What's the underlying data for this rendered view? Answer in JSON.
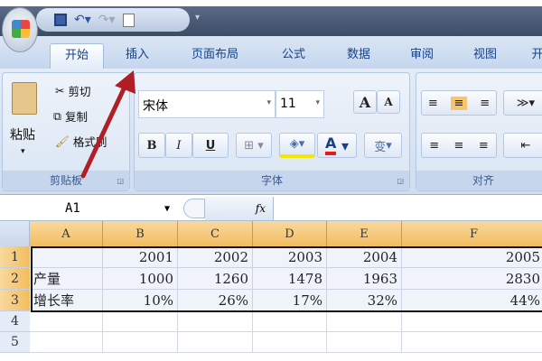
{
  "tabs": [
    "开始",
    "插入",
    "页面布局",
    "公式",
    "数据",
    "审阅",
    "视图",
    "开"
  ],
  "clipboard": {
    "paste": "粘贴",
    "cut": "剪切",
    "copy": "复制",
    "format_painter": "格式刷",
    "label": "剪贴板"
  },
  "font": {
    "name": "宋体",
    "size": "11",
    "grow": "A",
    "shrink": "A",
    "bold": "B",
    "italic": "I",
    "underline": "U",
    "font_color": "A",
    "phonetic": "变",
    "label": "字体"
  },
  "alignment": {
    "label": "对齐"
  },
  "formula_bar": {
    "name_box": "A1",
    "fx": "fx",
    "value": ""
  },
  "columns": [
    "A",
    "B",
    "C",
    "D",
    "E",
    "F"
  ],
  "rows": [
    {
      "num": "1",
      "cells": [
        "",
        "2001",
        "2002",
        "2003",
        "2004",
        "2005"
      ]
    },
    {
      "num": "2",
      "cells": [
        "产量",
        "1000",
        "1260",
        "1478",
        "1963",
        "2830"
      ]
    },
    {
      "num": "3",
      "cells": [
        "增长率",
        "10%",
        "26%",
        "17%",
        "32%",
        "44%"
      ]
    },
    {
      "num": "4",
      "cells": [
        "",
        "",
        "",
        "",
        "",
        ""
      ]
    },
    {
      "num": "5",
      "cells": [
        "",
        "",
        "",
        "",
        "",
        ""
      ]
    }
  ],
  "colors": {
    "accent": "#f2bc5e",
    "arrow": "#b01e28",
    "font_color_bar": "#e21b1b",
    "highlight_bar": "#f5e600"
  }
}
